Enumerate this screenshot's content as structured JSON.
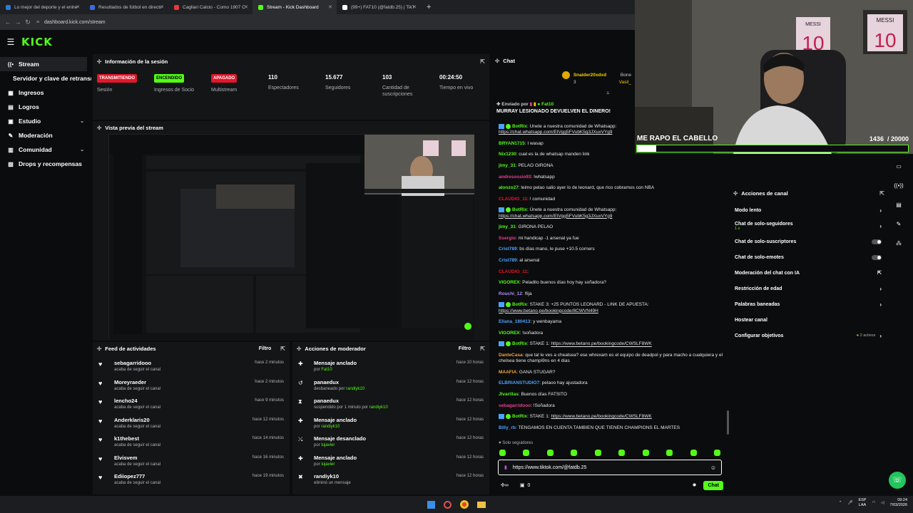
{
  "browser": {
    "tabs": [
      {
        "label": "Lo mejor del deporte y el entre",
        "color": "#2d7bd6"
      },
      {
        "label": "Resultados de fútbol en directo",
        "color": "#3b6be0"
      },
      {
        "label": "Cagliari Calcio - Como 1907 C",
        "color": "#e23b3b"
      },
      {
        "label": "Stream - Kick Dashboard",
        "color": "#53fc18"
      },
      {
        "label": "(99+) FAT10 (@fatdb.25) | TikTok",
        "color": "#ffffff"
      }
    ],
    "url": "dashboard.kick.com/stream"
  },
  "logo": "KICK",
  "sidebar": {
    "items": [
      {
        "label": "Stream",
        "icon": "broadcast-icon"
      },
      {
        "label": "Servidor y clave de retransmisión",
        "icon": ""
      },
      {
        "label": "Ingresos",
        "icon": "grid-icon"
      },
      {
        "label": "Logros",
        "icon": "trophy-icon"
      },
      {
        "label": "Estudio",
        "icon": "studio-icon"
      },
      {
        "label": "Moderación",
        "icon": "wrench-icon"
      },
      {
        "label": "Comunidad",
        "icon": "community-icon"
      },
      {
        "label": "Drops y recompensas",
        "icon": "gift-icon"
      }
    ]
  },
  "session": {
    "title": "Información de la sesión",
    "stats": [
      {
        "value": "TRANSMITIENDO",
        "label": "Sesión",
        "badge_color": "#e2172b",
        "is_badge": true
      },
      {
        "value": "ENCENDIDO",
        "label": "Ingresos de Socio",
        "badge_color": "#53fc18",
        "is_badge": true
      },
      {
        "value": "APAGADO",
        "label": "Multistream",
        "badge_color": "#e2172b",
        "is_badge": true
      },
      {
        "value": "110",
        "label": "Espectadores"
      },
      {
        "value": "15.677",
        "label": "Seguidores"
      },
      {
        "value": "103",
        "label": "Cantidad de suscripciones"
      },
      {
        "value": "00:24:50",
        "label": "Tiempo en vivo"
      }
    ]
  },
  "preview": {
    "title": "Vista previa del stream"
  },
  "feed": {
    "title": "Feed de actividades",
    "filter": "Filtro",
    "rows": [
      {
        "name": "sebagarridooo",
        "sub": "acaba de seguir el canal",
        "time": "hace 2 minutos"
      },
      {
        "name": "Moreyraeder",
        "sub": "acaba de seguir el canal",
        "time": "hace 2 minutos"
      },
      {
        "name": "lencho24",
        "sub": "acaba de seguir el canal",
        "time": "hace 9 minutos"
      },
      {
        "name": "Anderklaris20",
        "sub": "acaba de seguir el canal",
        "time": "hace 12 minutos"
      },
      {
        "name": "k1thebest",
        "sub": "acaba de seguir el canal",
        "time": "hace 14 minutos"
      },
      {
        "name": "Elvisvem",
        "sub": "acaba de seguir el canal",
        "time": "hace 16 minutos"
      },
      {
        "name": "Ediiopez777",
        "sub": "acaba de seguir el canal",
        "time": "hace 19 minutos"
      }
    ]
  },
  "mod": {
    "title": "Acciones de moderador",
    "filter": "Filtro",
    "rows": [
      {
        "icon": "pin-icon",
        "name": "Mensaje anclado",
        "pre": "por ",
        "by": "Fat10",
        "post": "",
        "time": "hace 10 horas"
      },
      {
        "icon": "undo-icon",
        "name": "panaedux",
        "pre": "desbaneado por ",
        "by": "randiyk10",
        "post": "",
        "time": "hace 12 horas"
      },
      {
        "icon": "hourglass-icon",
        "name": "panaedux",
        "pre": "suspendido por 1 minuto por ",
        "by": "randiyk10",
        "post": "",
        "time": "hace 12 horas"
      },
      {
        "icon": "pin-icon",
        "name": "Mensaje anclado",
        "pre": "por ",
        "by": "randiyk10",
        "post": "",
        "time": "hace 12 horas"
      },
      {
        "icon": "unpin-icon",
        "name": "Mensaje desanclado",
        "pre": "por ",
        "by": "lujavier",
        "post": "",
        "time": "hace 12 horas"
      },
      {
        "icon": "pin-icon",
        "name": "Mensaje anclado",
        "pre": "por ",
        "by": "lujavier",
        "post": "",
        "time": "hace 12 horas"
      },
      {
        "icon": "trash-icon",
        "name": "randiyk10",
        "pre": "eliminó un mensaje",
        "by": "",
        "post": "",
        "time": "hace 12 horas"
      }
    ]
  },
  "chat": {
    "title": "Chat",
    "leaderboard": {
      "name": "Snaider20xdxd",
      "count": "3",
      "name2": "Bone",
      "name3": "Vasil_"
    },
    "pinned": {
      "label": "Enviado por",
      "by": "Fat10",
      "text": "MURRAY LESIONADO DEVUELVEN EL DINERO!"
    },
    "lines": [
      {
        "user": "BotRix",
        "color": "#53fc18",
        "bot": true,
        "text": ": Únete a nuestra comunidad de Whatsapp:",
        "link": "https://chat.whatsapp.com/EtVgg5FVubK5g3JXuxVYg9"
      },
      {
        "user": "BRYAN1715",
        "color": "#53fc18",
        "text": ": I wasap"
      },
      {
        "user": "Nix1230",
        "color": "#53fc18",
        "text": ": cual es la de whatsap manden link"
      },
      {
        "user": "jimy_31",
        "color": "#53fc18",
        "text": ": PELAO GIRONA"
      },
      {
        "user": "andresossio93",
        "color": "#e83f8e",
        "text": ": !whatsapp"
      },
      {
        "user": "alonzo27",
        "color": "#53fc18",
        "text": ": leimo pelao salio ayer lo de leonard, que rico cobramos con NBA"
      },
      {
        "user": "CLAUDIO_11",
        "color": "#e2172b",
        "text": ": ! comunidad"
      },
      {
        "user": "BotRix",
        "color": "#53fc18",
        "bot": true,
        "text": ": Únete a nuestra comunidad de Whatsapp:",
        "link": "https://chat.whatsapp.com/EtVgg5FVubK5g3JXuxVYg9"
      },
      {
        "user": "jimy_31",
        "color": "#53fc18",
        "text": ": GIRONA PELAO"
      },
      {
        "user": "Ssergio",
        "color": "#e83f8e",
        "text": ": mi handicap -1 arsenal ya fue"
      },
      {
        "user": "Crist789",
        "color": "#4aa3ff",
        "text": ": bs días mano, le puse +10.5 corners"
      },
      {
        "user": "Crist789",
        "color": "#4aa3ff",
        "text": ": al arsenal"
      },
      {
        "user": "CLAUDIO_11",
        "color": "#e2172b",
        "text": ":"
      },
      {
        "user": "VIGOREX",
        "color": "#53fc18",
        "text": ": Peladito buenos días hoy hay soñadora?"
      },
      {
        "user": "Rouchi_12",
        "color": "#b28cff",
        "text": ": !fija"
      },
      {
        "user": "BotRix",
        "color": "#53fc18",
        "bot": true,
        "text": ": STAKE 3: +25 PUNTOS LEONARD - LINK DE APUESTA:",
        "link": "https://www.betano.pe/bookingcode/8CWVN49H"
      },
      {
        "user": "Eliana_180413",
        "color": "#4aa3ff",
        "text": ": y wenbayama"
      },
      {
        "user": "VIGOREX",
        "color": "#53fc18",
        "text": ": !soñadora"
      },
      {
        "user": "BotRix",
        "color": "#53fc18",
        "bot": true,
        "text": ": STAKE 1: ",
        "link": "https://www.betano.pe/bookingcode/CWSLF8WK"
      },
      {
        "user": "DanteCasa",
        "color": "#f0a040",
        "text": ": que tal le ves a chealsea? ese whrexam es el equipo de deadpol y para macho a cualquiera y el chelsea tiene champi9ns en 4 dias"
      },
      {
        "user": "MAAFIA",
        "color": "#f0a040",
        "text": ": GANA STUGAR?"
      },
      {
        "user": "ELBRIANSTUDIO7",
        "color": "#4aa3ff",
        "text": ": pelaoo hay ajustadora"
      },
      {
        "user": "Jlvarillas",
        "color": "#53fc18",
        "text": ": Buenos días FATSITO"
      },
      {
        "user": "sebagarridooo",
        "color": "#e83f8e",
        "text": ": !Soñadora"
      },
      {
        "user": "BotRix",
        "color": "#53fc18",
        "bot": true,
        "text": ": STAKE 1: ",
        "link": "https://www.betano.pe/bookingcode/CWSLF8WK"
      },
      {
        "user": "Billy_rb",
        "color": "#4aa3ff",
        "text": ": TENGAMOS EN CUENTA TAMBIEN QUE TIENEN CHAMPIONS EL MARTES"
      }
    ],
    "followers_only": "Solo seguidores",
    "input_value": "https://www.tiktok.com/@fatdb.25",
    "points": "0",
    "send": "Chat"
  },
  "actions": {
    "title": "Acciones de canal",
    "items": [
      {
        "label": "Modo lento",
        "control": "chevron"
      },
      {
        "label": "Chat de solo-seguidores",
        "sub": "1 s",
        "control": "chevron"
      },
      {
        "label": "Chat de solo-suscriptores",
        "control": "toggle"
      },
      {
        "label": "Chat de solo-emotes",
        "control": "toggle"
      },
      {
        "label": "Moderación del chat con IA",
        "control": "external"
      },
      {
        "label": "Restricción de edad",
        "control": "chevron"
      },
      {
        "label": "Palabras baneadas",
        "control": "chevron"
      },
      {
        "label": "Hostear canal",
        "control": "none"
      },
      {
        "label": "Configurar objetivos",
        "badge": "2 activos",
        "control": "chevron"
      }
    ]
  },
  "camera": {
    "goal_label": "ME RAPO EL CABELLO",
    "goal_count": "1436",
    "goal_total": "/ 20000",
    "goal_progress": 0.0718,
    "jersey_text": "MESSI",
    "jersey_number": "10"
  },
  "taskbar": {
    "lang": "ESP",
    "lang2": "LAA",
    "time": "09:24",
    "date": "7/03/2026"
  }
}
